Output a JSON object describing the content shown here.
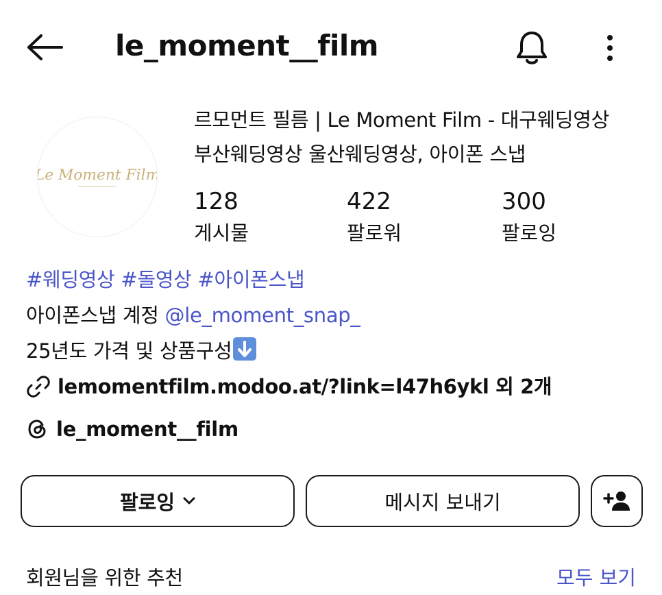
{
  "header": {
    "username": "le_moment__film",
    "back_icon": "arrow-left-icon",
    "notification_icon": "bell-icon",
    "more_icon": "more-vertical-icon"
  },
  "profile": {
    "avatar_text": "Le Moment Film",
    "name_line1": "르모먼트 필름 | Le Moment Film - 대구웨딩영상",
    "name_line2": "부산웨딩영상 울산웨딩영상, 아이폰 스냅",
    "stats": [
      {
        "value": "128",
        "label": "게시물"
      },
      {
        "value": "422",
        "label": "팔로워"
      },
      {
        "value": "300",
        "label": "팔로잉"
      }
    ]
  },
  "bio": {
    "hashtags": "#웨딩영상 #돌영상 #아이폰스냅",
    "account_prefix": "아이폰스냅 계정 ",
    "account_mention": "@le_moment_snap_",
    "pricing_text": "25년도 가격 및 상품구성",
    "pricing_emoji": "down-arrow-emoji",
    "link_text": "lemomentfilm.modoo.at/?link=l47h6ykl 외 2개",
    "threads_handle": "le_moment__film"
  },
  "actions": {
    "following_label": "팔로잉",
    "message_label": "메시지 보내기",
    "add_user_icon": "add-user-icon"
  },
  "suggestions": {
    "title": "회원님을 위한 추천",
    "see_all_label": "모두 보기"
  },
  "colors": {
    "link_blue": "#4a55c8",
    "text": "#111111",
    "border": "#1a1a1a",
    "logo_gold": "#c9b27a"
  }
}
